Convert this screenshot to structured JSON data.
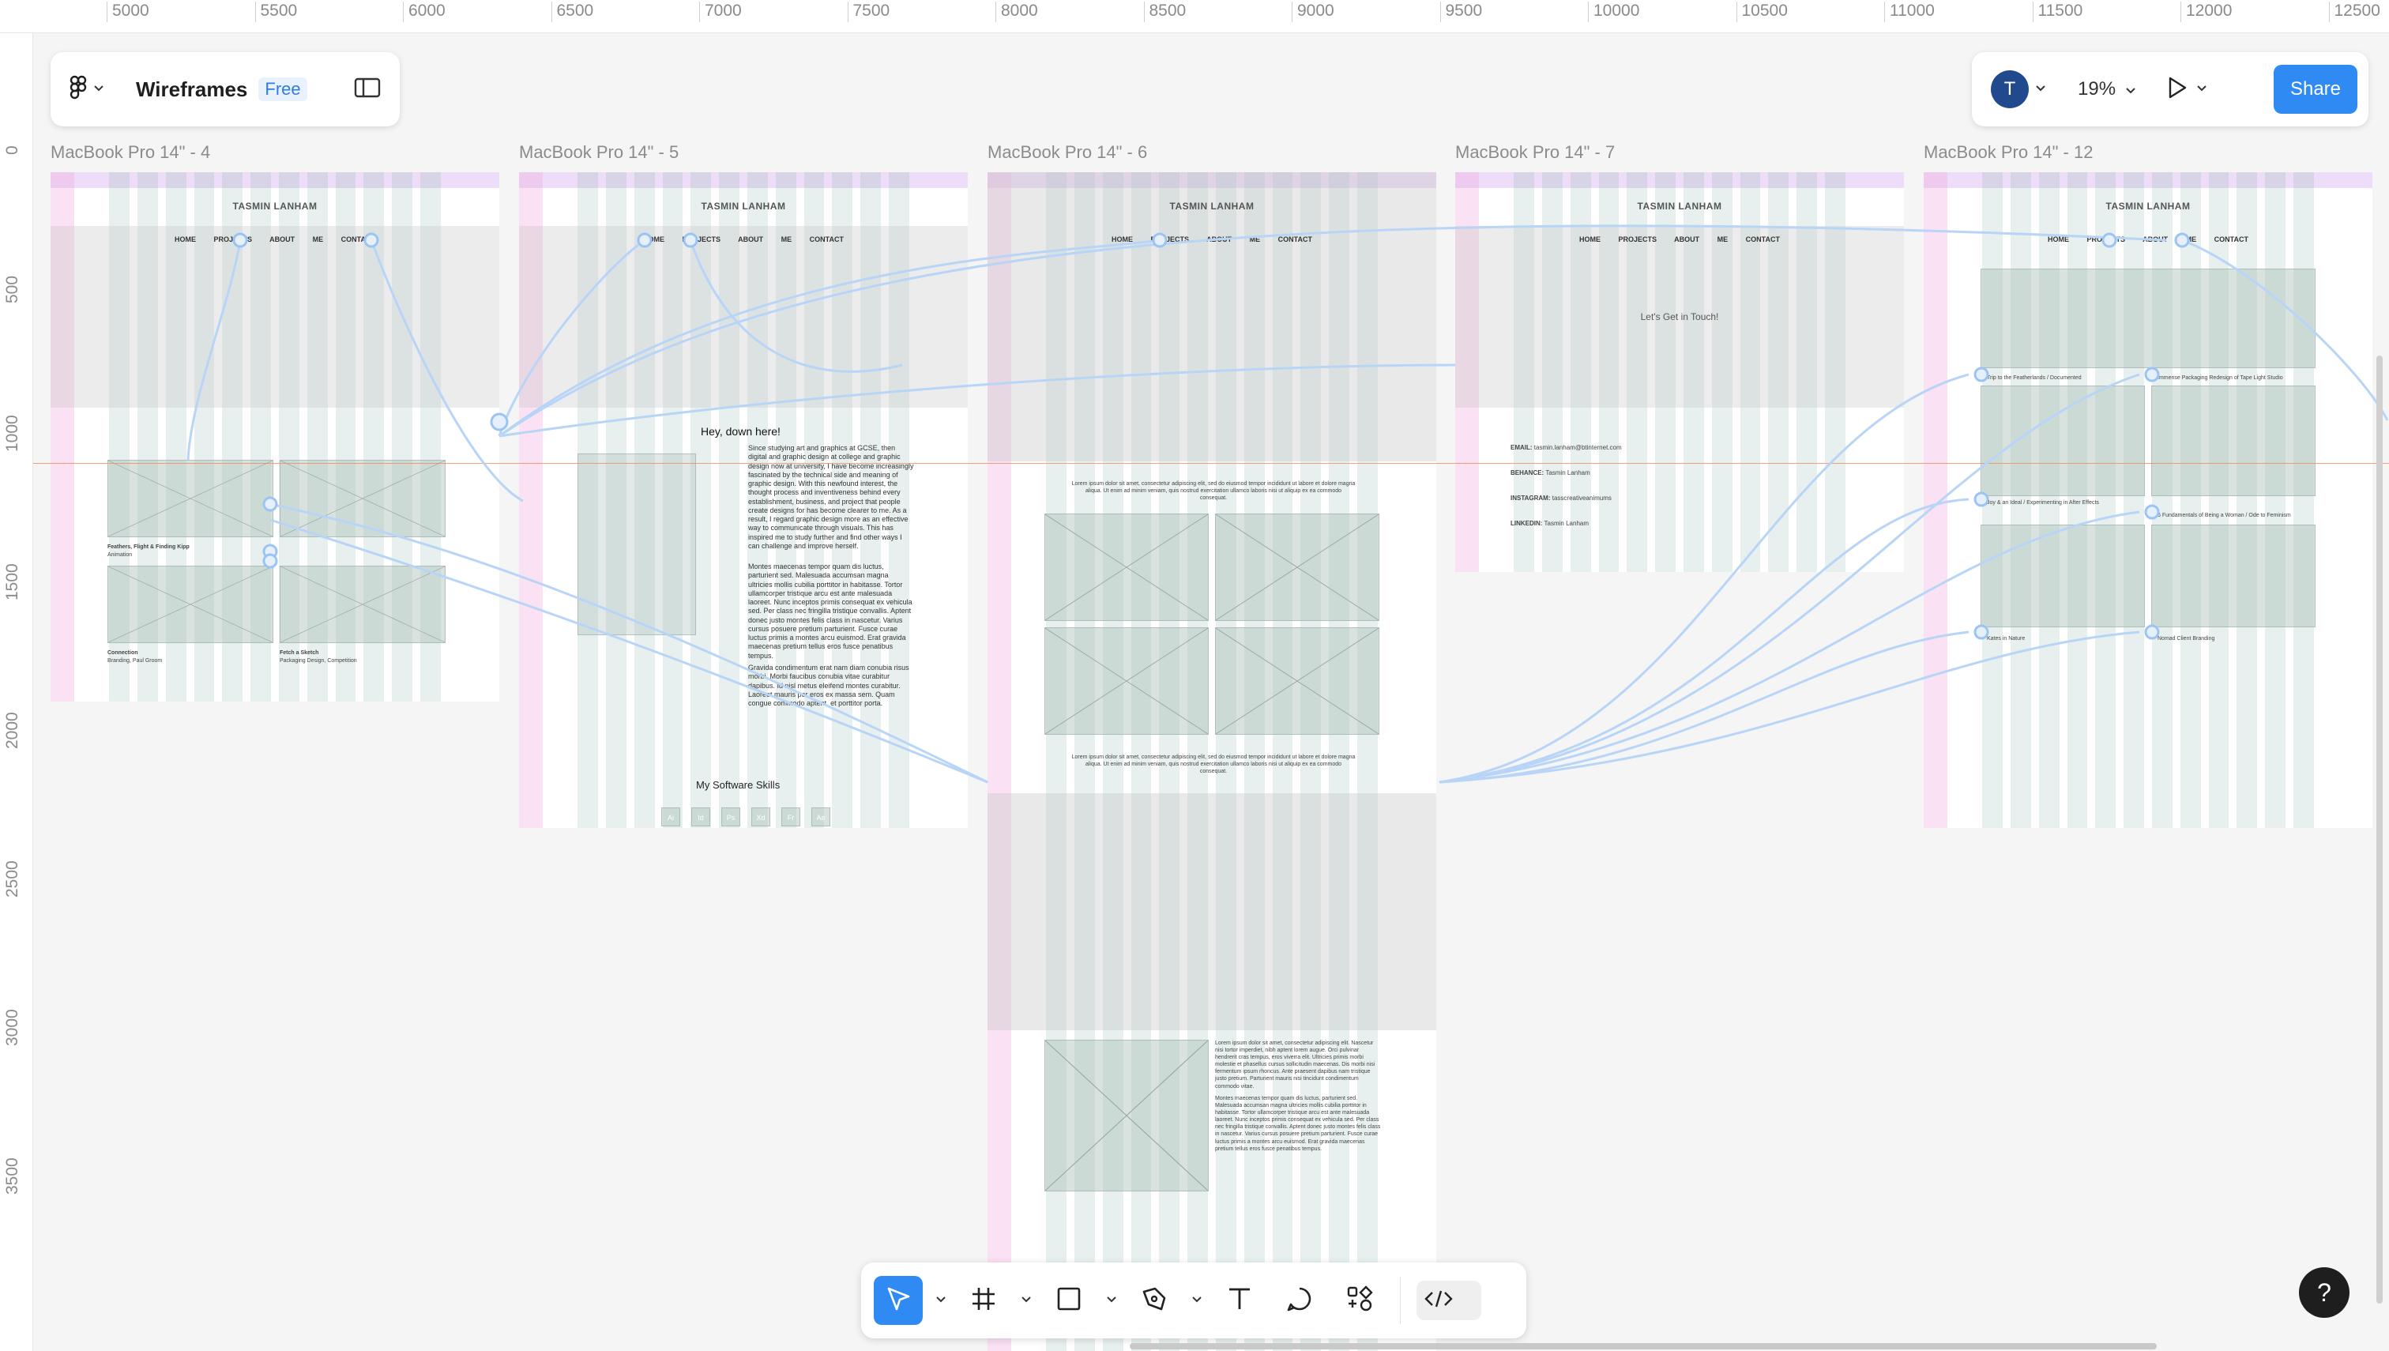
{
  "app": {
    "file_title": "Wireframes",
    "plan_badge": "Free",
    "accent_color": "#2f8bf3"
  },
  "ruler": {
    "x_ticks": [
      "5000",
      "5500",
      "6000",
      "6500",
      "7000",
      "7500",
      "8000",
      "8500",
      "9000",
      "9500",
      "10000",
      "10500",
      "11000",
      "11500",
      "12000",
      "12500"
    ],
    "y_ticks": [
      "0",
      "500",
      "1000",
      "1500",
      "2000",
      "2500",
      "3000",
      "3500"
    ]
  },
  "header_right": {
    "avatar_initial": "T",
    "zoom_level": "19%",
    "share_label": "Share"
  },
  "frames": [
    {
      "label": "MacBook Pro 14\" - 4",
      "brand": "TASMIN LANHAM",
      "nav": "HOME PROJECTS ABOUT ME CONTACT",
      "captions": [
        "Feathers, Flight & Finding Kipp",
        "Animation",
        "Connection",
        "Branding, Paul Groom",
        "Fetch a Sketch",
        "Packaging Design, Competition"
      ]
    },
    {
      "label": "MacBook Pro 14\" - 5",
      "brand": "TASMIN LANHAM",
      "nav": "HOME PROJECTS ABOUT ME CONTACT",
      "greeting": "Hey, down here!",
      "about_p1": "Since studying art and graphics at GCSE, then digital and graphic design at college and graphic design now at university, I have become increasingly fascinated by the technical side and meaning of graphic design. With this newfound interest, the thought process and inventiveness behind every establishment, business, and project that people create designs for has become clearer to me. As a result, I regard graphic design more as an effective way to communicate through visuals. This has inspired me to study further and find other ways I can challenge and improve herself.",
      "about_p2": "Montes maecenas tempor quam dis luctus, parturient sed. Malesuada accumsan magna ultricies mollis cubilia porttitor in habitasse. Tortor ullamcorper tristique arcu est ante malesuada laoreet. Nunc inceptos primis consequat ex vehicula sed. Per class nec fringilla tristique convallis. Aptent donec justo montes felis class in nascetur. Varius cursus posuere pretium parturient. Fusce curae luctus primis a montes arcu euismod. Erat gravida maecenas pretium tellus eros fusce penatibus tempus.",
      "about_p3": "Gravida condimentum erat nam diam conubia risus morbi. Morbi faucibus conubia vitae curabitur dapibus. Id nisl metus eleifend montes curabitur. Laoreet mauris per eros ex massa sem. Quam congue commodo aptent, et porttitor porta.",
      "software_heading": "My Software Skills",
      "software_icons": [
        "Ai",
        "Id",
        "Ps",
        "Xd",
        "Fr",
        "Ae"
      ]
    },
    {
      "label": "MacBook Pro 14\" - 6",
      "brand": "TASMIN LANHAM",
      "nav": "HOME PROJECTS ABOUT ME CONTACT",
      "lorem_short": "Lorem ipsum dolor sit amet, consectetur adipiscing elit, sed do eiusmod tempor incididunt ut labore et dolore magna aliqua. Ut enim ad minim veniam, quis nostrud exercitation ullamco laboris nisi ut aliquip ex ea commodo consequat.",
      "lorem_long_1": "Lorem ipsum dolor sit amet, consectetur adipiscing elit. Nascetur nisi tortor imperdiet, nibh aptent lorem augue. Orci pulvinar hendrerit cras tempus, eros viverra elit. Ultricies primis morbi molestie et phasellus cursus sollicitudin maecenas. Dis morbi nisi fermentum ipsum rhoncus. Ante praesent dapibus nam tristique justo pretium. Parturient mauris nisi tincidunt condimentum commodo vitae.",
      "lorem_long_2": "Montes maecenas tempor quam dis luctus, parturient sed. Malesuada accumsan magna ultricies mollis cubilia porttitor in habitasse. Tortor ullamcorper tristique arcu est ante malesuada laoreet. Nunc inceptos primis consequat ex vehicula sed. Per class nec fringilla tristique convallis. Aptent donec justo montes felis class in nascetur. Varius cursus posuere pretium parturient. Fusce curae luctus primis a montes arcu euismod. Erat gravida maecenas pretium tellus eros fusce penatibus tempus."
    },
    {
      "label": "MacBook Pro 14\" - 7",
      "brand": "TASMIN LANHAM",
      "nav": "HOME PROJECTS ABOUT ME CONTACT",
      "hero_text": "Let's Get in Touch!",
      "contact": [
        {
          "label": "EMAIL:",
          "value": "tasmin.lanham@btinternet.com"
        },
        {
          "label": "BEHANCE:",
          "value": "Tasmin Lanham"
        },
        {
          "label": "INSTAGRAM:",
          "value": "tasscreativeanimums"
        },
        {
          "label": "LINKEDIN:",
          "value": "Tasmin Lanham"
        }
      ]
    },
    {
      "label": "MacBook Pro 14\" - 12",
      "brand": "TASMIN LANHAM",
      "nav": "HOME PROJECTS ABOUT ME CONTACT",
      "items": [
        "Trip to the Featherlands / Documented",
        "Immense Packaging Redesign of Tape Light Studio",
        "Joy & an Ideal / Experimenting in After Effects",
        "6 Fundamentals of Being a Woman / Ode to Feminism",
        "Kates in Nature",
        "Nomad Client Branding"
      ]
    }
  ],
  "toolbar": {
    "tools": [
      "move-tool",
      "frame-tool",
      "shape-tool",
      "pen-tool",
      "text-tool",
      "comment-tool",
      "actions-tool",
      "dev-mode-toggle"
    ]
  },
  "help_label": "?"
}
